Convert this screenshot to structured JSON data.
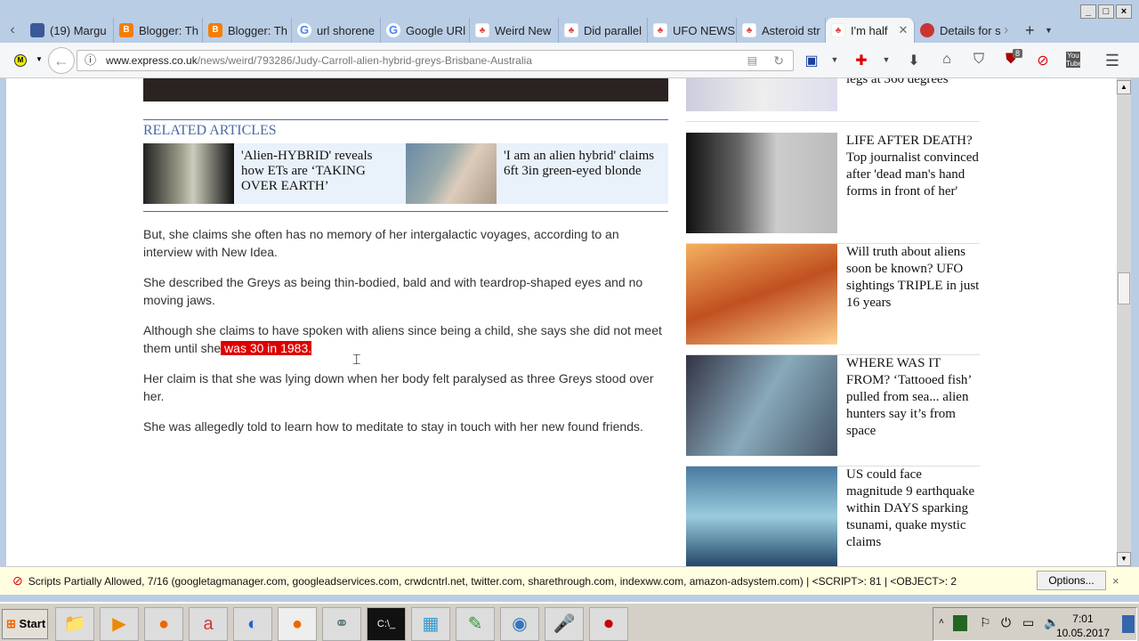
{
  "window": {
    "minimize": "_",
    "maximize": "□",
    "close": "×"
  },
  "tabs": [
    {
      "label": "(19) Margu",
      "icon": "facebook-icon"
    },
    {
      "label": "Blogger: Th",
      "icon": "blogger-icon"
    },
    {
      "label": "Blogger: Th",
      "icon": "blogger-icon"
    },
    {
      "label": "url shorene",
      "icon": "google-icon"
    },
    {
      "label": "Google URl",
      "icon": "google-icon"
    },
    {
      "label": "Weird New",
      "icon": "express-icon"
    },
    {
      "label": "Did parallel",
      "icon": "express-icon"
    },
    {
      "label": "UFO NEWS",
      "icon": "express-icon"
    },
    {
      "label": "Asteroid str",
      "icon": "express-icon"
    },
    {
      "label": "I'm half",
      "icon": "express-icon",
      "active": true
    },
    {
      "label": "Details for s",
      "icon": "crest-icon"
    }
  ],
  "nav": {
    "url_domain": "www.express.co.uk",
    "url_path": "/news/weird/793286/Judy-Carroll-alien-hybrid-greys-Brisbane-Australia",
    "ublock_count": "8",
    "youtube": "You Tube"
  },
  "article": {
    "related_title": "RELATED ARTICLES",
    "related": [
      {
        "title": "'Alien-HYBRID' reveals how ETs are ‘TAKING OVER EARTH’"
      },
      {
        "title": "'I am an alien hybrid' claims 6ft 3in green-eyed blonde"
      }
    ],
    "paragraphs": [
      "But, she claims she often has no memory of her intergalactic voyages, according to an interview with New Idea.",
      "She described the Greys as being thin-bodied, bald and with teardrop-shaped eyes and no moving jaws."
    ],
    "p3_before": "Although she claims to have spoken with aliens since being a child, she says she did not meet them until she",
    "p3_highlight": " was 30 in 1983.",
    "paragraphs2": [
      "Her claim is that she was lying down when her body felt paralysed as three Greys stood over her.",
      "She was allegedly told to learn how to meditate to stay in touch with her new found friends."
    ]
  },
  "sidebar": [
    {
      "title": "legs at 360 degrees"
    },
    {
      "title": "LIFE AFTER DEATH? Top journalist convinced after 'dead man's hand forms in front of her'"
    },
    {
      "title": "Will truth about aliens soon be known? UFO sightings TRIPLE in just 16 years"
    },
    {
      "title": "WHERE WAS IT FROM? ‘Tattooed fish’ pulled from sea... alien hunters say it’s from space"
    },
    {
      "title": "US could face magnitude 9 earthquake within DAYS sparking tsunami, quake mystic claims"
    }
  ],
  "notification": {
    "text": "Scripts Partially Allowed, 7/16 (googletagmanager.com, googleadservices.com, crwdcntrl.net, twitter.com, sharethrough.com, indexww.com, amazon-adsystem.com) | <SCRIPT>: 81 | <OBJECT>: 2",
    "options": "Options...",
    "close": "×"
  },
  "taskbar": {
    "start": "Start",
    "time": "7:01",
    "date": "10.05.2017"
  }
}
